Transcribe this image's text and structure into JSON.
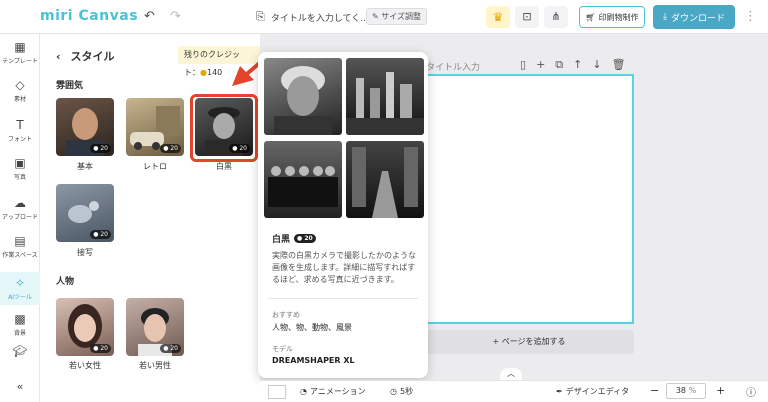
{
  "header": {
    "logo": "miri Canvas",
    "title": "タイトルを入力してく...",
    "size_label": "サイズ調整",
    "print_label": "印刷物制作",
    "download_label": "ダウンロード"
  },
  "rail": {
    "items": [
      {
        "label": "テンプレート",
        "icon": "template-icon"
      },
      {
        "label": "素材",
        "icon": "shapes-icon"
      },
      {
        "label": "フォント",
        "icon": "text-icon"
      },
      {
        "label": "写真",
        "icon": "image-icon"
      },
      {
        "label": "アップロード",
        "icon": "cloud-upload-icon"
      },
      {
        "label": "作業スペース",
        "icon": "folder-icon"
      },
      {
        "label": "AIツール",
        "icon": "sparkle-icon"
      },
      {
        "label": "背景",
        "icon": "pattern-icon"
      }
    ]
  },
  "panel": {
    "title": "スタイル",
    "credit_label": "残りのクレジット：",
    "credit_value": "140",
    "section_atmosphere": "雰囲気",
    "section_person": "人物",
    "badge": "20",
    "styles": [
      {
        "label": "基本"
      },
      {
        "label": "レトロ"
      },
      {
        "label": "白黒"
      },
      {
        "label": "接写"
      }
    ],
    "people": [
      {
        "label": "若い女性"
      },
      {
        "label": "若い男性"
      }
    ]
  },
  "canvas": {
    "title_placeholder": "タイトル入力",
    "add_page": "ページを追加する"
  },
  "popup": {
    "title": "白黒",
    "badge": "20",
    "description": "実際の白黒カメラで撮影したかのような画像を生成します。詳細に描写すればするほど、求める写真に近づきます。",
    "recommend_label": "おすすめ",
    "recommend_value": "人物、物、動物、風景",
    "model_label": "モデル",
    "model_value": "DREAMSHAPER XL"
  },
  "bottom": {
    "animation": "アニメーション",
    "duration": "5秒",
    "design_editor": "デザインエディタ",
    "zoom": "38",
    "zoom_unit": "%"
  },
  "colors": {
    "accent": "#4ac3d6",
    "highlight": "#e2452a"
  }
}
